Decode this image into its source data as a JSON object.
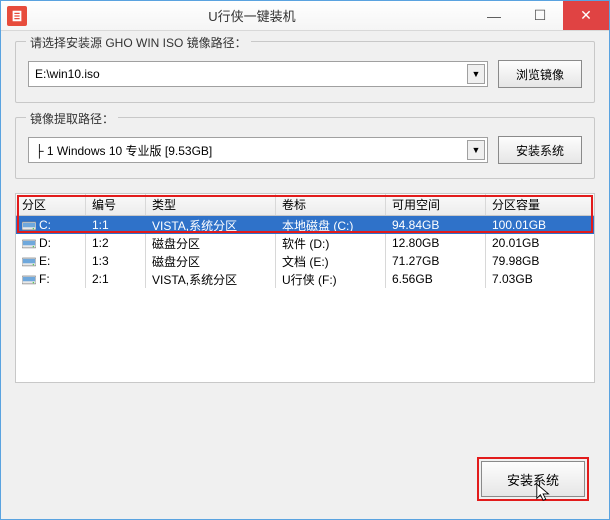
{
  "title": "U行侠一键装机",
  "group1": {
    "label": "请选择安装源 GHO WIN ISO 镜像路径：",
    "value": "E:\\win10.iso",
    "browse": "浏览镜像"
  },
  "group2": {
    "label": "镜像提取路径：",
    "value": "├ 1 Windows 10 专业版 [9.53GB]",
    "install": "安装系统"
  },
  "table": {
    "headers": [
      "分区",
      "编号",
      "类型",
      "卷标",
      "可用空间",
      "分区容量"
    ],
    "rows": [
      {
        "p": "C:",
        "n": "1:1",
        "t": "VISTA,系统分区",
        "v": "本地磁盘 (C:)",
        "f": "94.84GB",
        "s": "100.01GB",
        "sel": true
      },
      {
        "p": "D:",
        "n": "1:2",
        "t": "磁盘分区",
        "v": "软件 (D:)",
        "f": "12.80GB",
        "s": "20.01GB",
        "sel": false
      },
      {
        "p": "E:",
        "n": "1:3",
        "t": "磁盘分区",
        "v": "文档 (E:)",
        "f": "71.27GB",
        "s": "79.98GB",
        "sel": false
      },
      {
        "p": "F:",
        "n": "2:1",
        "t": "VISTA,系统分区",
        "v": "U行侠 (F:)",
        "f": "6.56GB",
        "s": "7.03GB",
        "sel": false
      }
    ]
  },
  "footer": {
    "install": "安装系统"
  }
}
